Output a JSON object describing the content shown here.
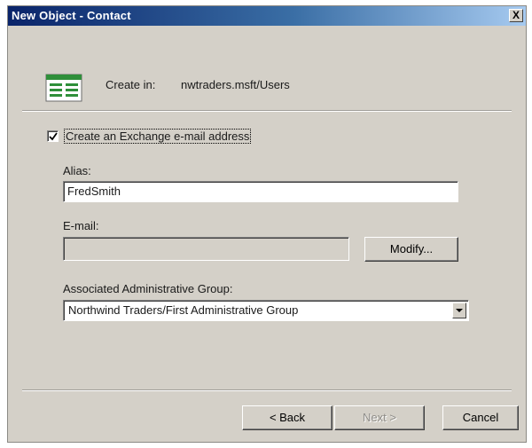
{
  "window": {
    "title": "New Object - Contact",
    "close_label": "X"
  },
  "header": {
    "icon": "contact-card-icon",
    "create_in_label": "Create in:",
    "create_in_value": "nwtraders.msft/Users"
  },
  "exchange": {
    "checkbox_checked": true,
    "checkbox_label": "Create an Exchange e-mail address"
  },
  "alias": {
    "label": "Alias:",
    "value": "FredSmith"
  },
  "email": {
    "label": "E-mail:",
    "value": "",
    "modify_label": "Modify..."
  },
  "admin_group": {
    "label": "Associated Administrative Group:",
    "selected": "Northwind Traders/First Administrative Group"
  },
  "footer": {
    "back_label": "< Back",
    "next_label": "Next >",
    "cancel_label": "Cancel"
  },
  "colors": {
    "dialog_bg": "#d4d0c8",
    "titlebar_start": "#0a246a",
    "titlebar_end": "#a6caf0"
  }
}
